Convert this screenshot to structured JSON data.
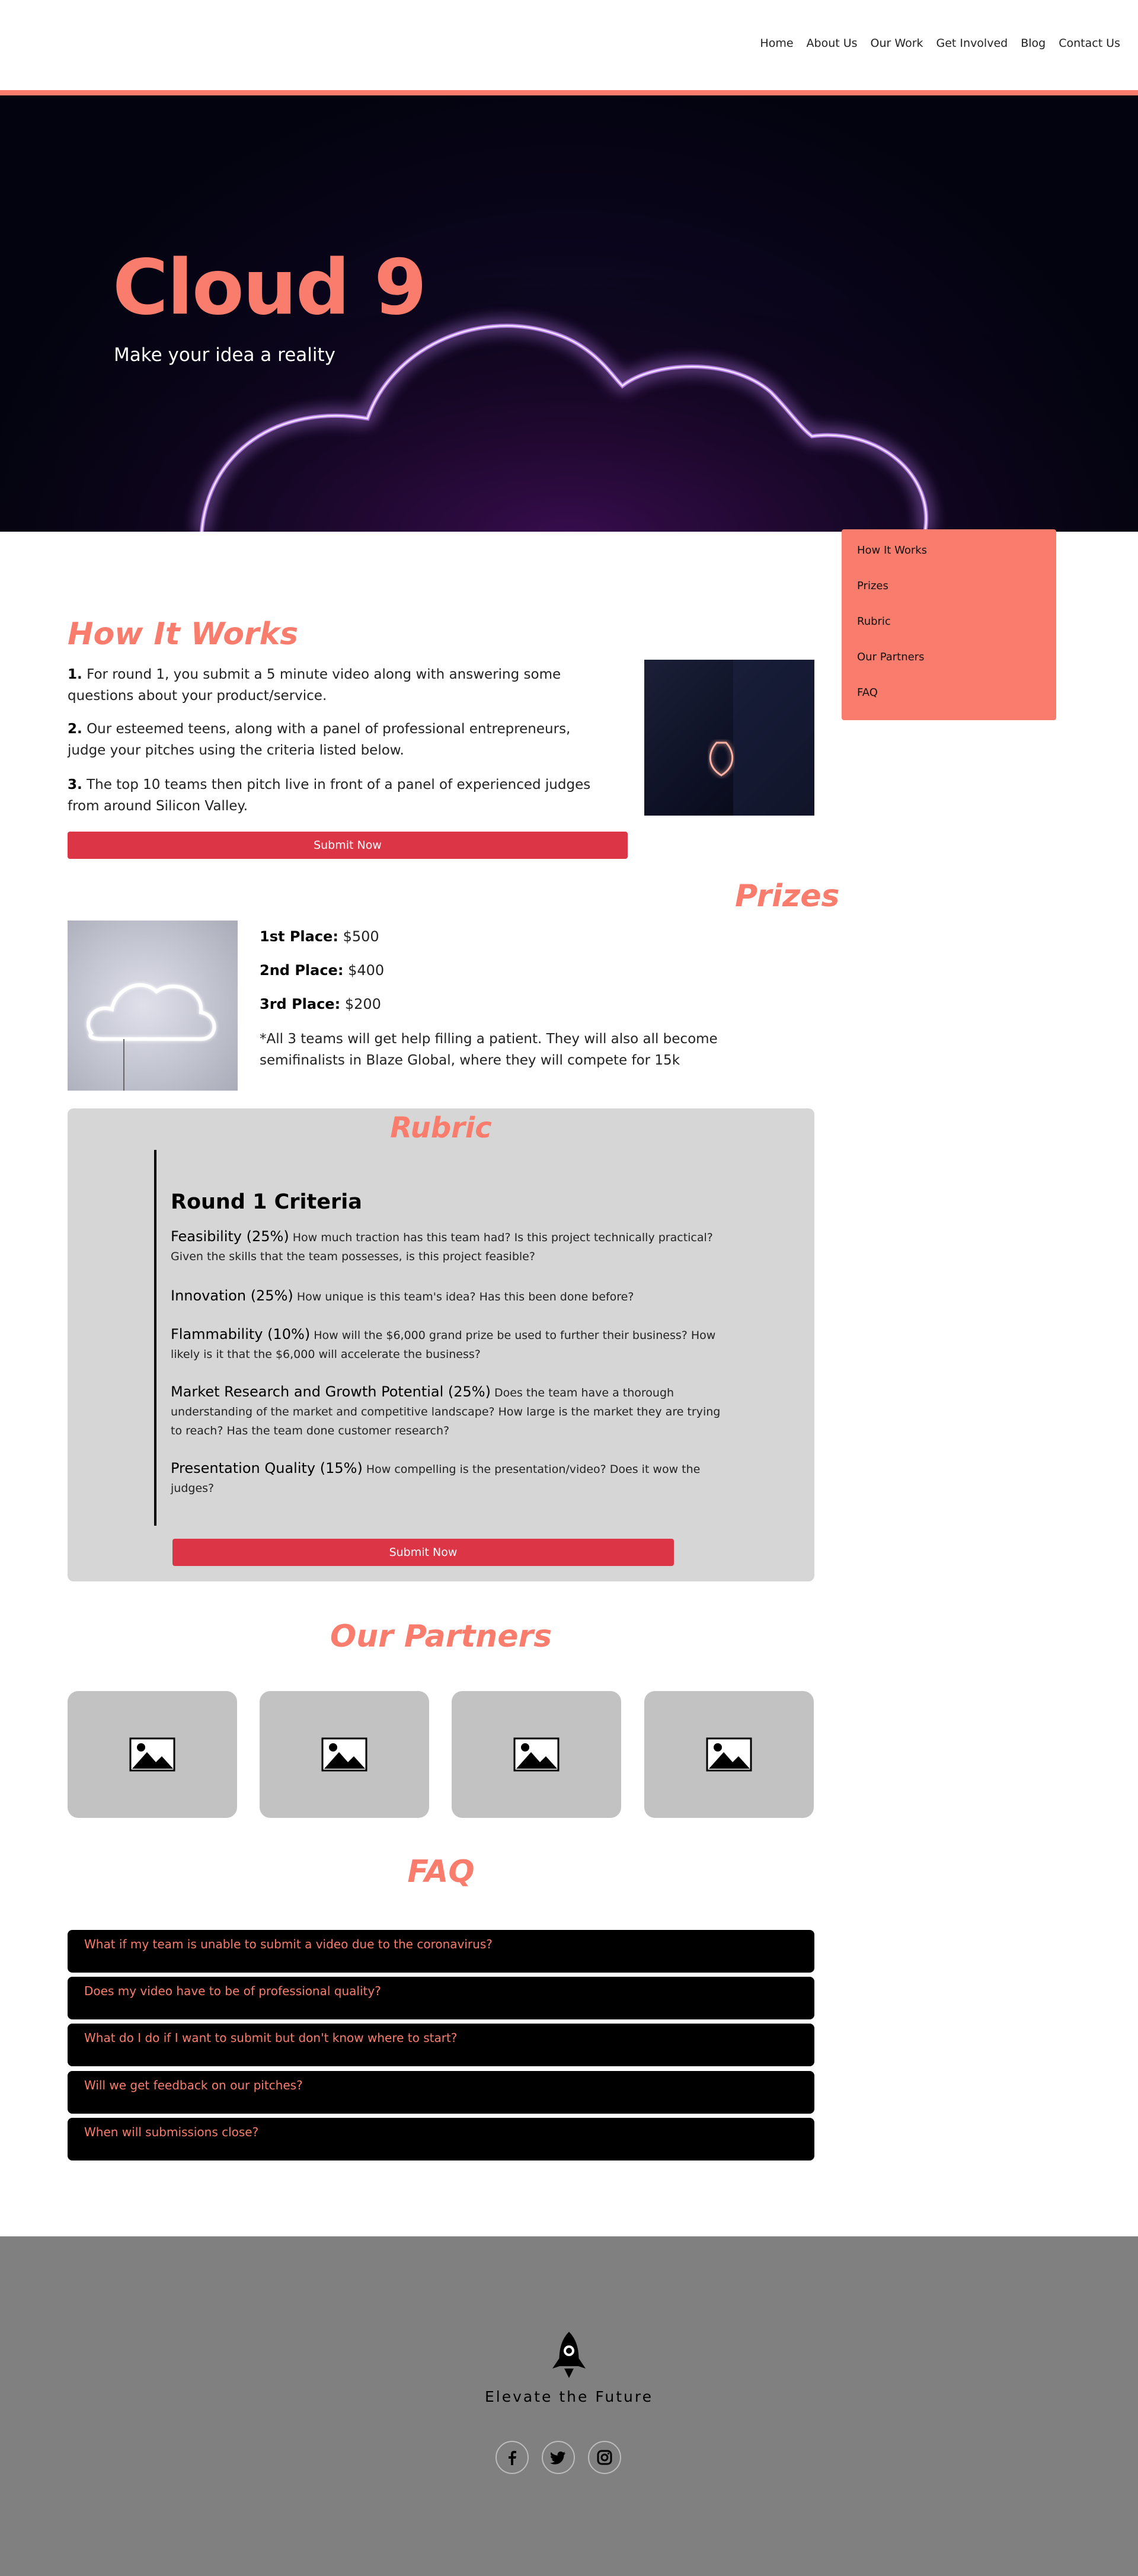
{
  "nav": {
    "items": [
      "Home",
      "About Us",
      "Our Work",
      "Get Involved",
      "Blog",
      "Contact Us"
    ]
  },
  "hero": {
    "title": "Cloud 9",
    "subtitle": "Make your idea a reality"
  },
  "sidemenu": {
    "items": [
      "How It Works",
      "Prizes",
      "Rubric",
      "Our Partners",
      "FAQ"
    ]
  },
  "how_it_works": {
    "heading": "How It Works",
    "steps": [
      {
        "num": "1.",
        "text": "For round 1, you submit a 5 minute video along with answering some questions about your product/service."
      },
      {
        "num": "2.",
        "text": "Our esteemed teens, along with a panel of professional entrepreneurs, judge your pitches using the criteria listed below."
      },
      {
        "num": "3.",
        "text": "The top 10 teams then pitch live in front of a panel of experienced judges from around Silicon Valley."
      }
    ],
    "button": "Submit Now"
  },
  "prizes": {
    "heading": "Prizes",
    "items": [
      {
        "label": "1st Place:",
        "value": "$500"
      },
      {
        "label": "2nd Place:",
        "value": "$400"
      },
      {
        "label": "3rd Place:",
        "value": "$200"
      }
    ],
    "note": "*All 3 teams will get help filling a patient. They will also all become semifinalists in Blaze Global, where they will compete for 15k"
  },
  "rubric": {
    "heading": "Rubric",
    "criteria_title": "Round 1 Criteria",
    "criteria": [
      {
        "label": "Feasibility (25%)",
        "text": "How much traction has this team had? Is this project technically practical? Given the skills that the team possesses, is this project feasible?"
      },
      {
        "label": "Innovation (25%)",
        "text": "How unique is this team's idea? Has this been done before?"
      },
      {
        "label": "Flammability (10%)",
        "text": "How will the $6,000 grand prize be used to further their business? How likely is it that the $6,000 will accelerate the business?"
      },
      {
        "label": "Market Research and Growth Potential (25%)",
        "text": "Does the team have a thorough understanding of the market and competitive landscape? How large is the market they are trying to reach? Has the team done customer research?"
      },
      {
        "label": "Presentation Quality (15%)",
        "text": "How compelling is the presentation/video? Does it wow the judges?"
      }
    ],
    "button": "Submit Now"
  },
  "partners": {
    "heading": "Our Partners",
    "logos": [
      "image-placeholder-icon",
      "image-placeholder-icon",
      "image-placeholder-icon",
      "image-placeholder-icon"
    ]
  },
  "faq": {
    "heading": "FAQ",
    "questions": [
      "What if my team is unable to submit a video due to the coronavirus?",
      "Does my video have to be of professional quality?",
      "What do I do if I want to submit but don't know where to start?",
      "Will we get feedback on our pitches?",
      "When will submissions close?"
    ]
  },
  "footer": {
    "tagline": "Elevate the Future",
    "logo": "rocket-icon",
    "social": [
      "facebook-icon",
      "twitter-icon",
      "instagram-icon"
    ]
  },
  "colors": {
    "accent": "#fa7c6c",
    "button": "#dc3545",
    "footer": "#808080",
    "rubric_bg": "#d6d6d6"
  }
}
